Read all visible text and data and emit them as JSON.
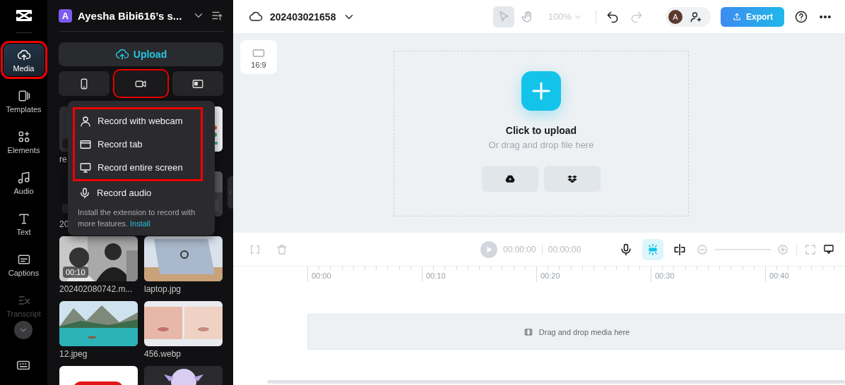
{
  "rail": {
    "items": [
      {
        "label": "Media",
        "selected": true,
        "faded": false,
        "highlighted": true
      },
      {
        "label": "Templates",
        "selected": false,
        "faded": false,
        "highlighted": false
      },
      {
        "label": "Elements",
        "selected": false,
        "faded": false,
        "highlighted": false
      },
      {
        "label": "Audio",
        "selected": false,
        "faded": false,
        "highlighted": false
      },
      {
        "label": "Text",
        "selected": false,
        "faded": false,
        "highlighted": false
      },
      {
        "label": "Captions",
        "selected": false,
        "faded": false,
        "highlighted": false
      },
      {
        "label": "Transcript",
        "selected": false,
        "faded": true,
        "highlighted": false
      }
    ]
  },
  "panel": {
    "workspace_initial": "A",
    "workspace_name": "Ayesha Bibi616’s s...",
    "upload": "Upload",
    "sources": [
      {
        "highlighted": false
      },
      {
        "highlighted": true
      },
      {
        "highlighted": false
      }
    ],
    "menu": {
      "items": [
        {
          "label": "Record with webcam",
          "highlighted": true
        },
        {
          "label": "Record tab",
          "highlighted": true
        },
        {
          "label": "Record entire screen",
          "highlighted": true
        },
        {
          "label": "Record audio",
          "highlighted": false
        }
      ],
      "note": "Install the extension to record with more features.",
      "link": "Install"
    },
    "media": [
      {
        "kind": "picture",
        "label": "re"
      },
      {
        "kind": "picture"
      },
      {
        "kind": "picture",
        "label": "20"
      },
      {
        "kind": "picture"
      },
      {
        "kind": "picture",
        "label": "202402080742.m...",
        "duration": "00:10"
      },
      {
        "kind": "picture",
        "label": "laptop.jpg"
      },
      {
        "kind": "picture",
        "label": "12.jpeg"
      },
      {
        "kind": "picture",
        "label": "456.webp"
      },
      {
        "kind": "picture"
      },
      {
        "kind": "picture"
      }
    ]
  },
  "topbar": {
    "project": "202403021658",
    "tools": [
      {
        "selected": true
      },
      {
        "selected": false
      }
    ],
    "zoom": "100%",
    "history": [
      {
        "disabled": false
      },
      {
        "disabled": true
      }
    ],
    "avatar": "A",
    "export": "Export"
  },
  "canvas": {
    "ratio": "16:9",
    "title": "Click to upload",
    "subtitle": "Or drag and drop file here"
  },
  "timeline": {
    "current": "00:00:00",
    "total": "00:00:00",
    "toggles": [
      {
        "on": false
      },
      {
        "on": true
      },
      {
        "on": false
      }
    ],
    "ruler": [
      "00:00",
      "00:10",
      "00:20",
      "00:30",
      "00:40"
    ],
    "hint": "Drag and drop media here"
  }
}
